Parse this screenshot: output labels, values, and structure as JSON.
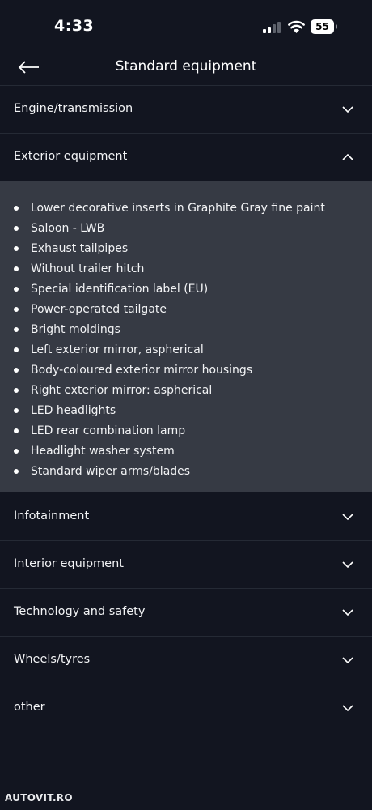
{
  "status_bar": {
    "time": "4:33",
    "battery": "55"
  },
  "header": {
    "back_icon": "arrow-left-icon",
    "title": "Standard equipment"
  },
  "sections": [
    {
      "label": "Engine/transmission",
      "expanded": false,
      "chevron": "chevron-down-icon"
    },
    {
      "label": "Exterior equipment",
      "expanded": true,
      "chevron": "chevron-up-icon"
    },
    {
      "label": "Infotainment",
      "expanded": false,
      "chevron": "chevron-down-icon"
    },
    {
      "label": "Interior equipment",
      "expanded": false,
      "chevron": "chevron-down-icon"
    },
    {
      "label": "Technology and safety",
      "expanded": false,
      "chevron": "chevron-down-icon"
    },
    {
      "label": "Wheels/tyres",
      "expanded": false,
      "chevron": "chevron-down-icon"
    },
    {
      "label": "other",
      "expanded": false,
      "chevron": "chevron-down-icon"
    }
  ],
  "exterior_items": [
    "Lower decorative inserts in Graphite Gray fine paint",
    "Saloon - LWB",
    "Exhaust tailpipes",
    "Without trailer hitch",
    "Special identification label (EU)",
    "Power-operated tailgate",
    "Bright moldings",
    "Left exterior mirror, aspherical",
    "Body-coloured exterior mirror housings",
    "Right exterior mirror: aspherical",
    "LED headlights",
    "LED rear combination lamp",
    "Headlight washer system",
    "Standard wiper arms/blades"
  ],
  "watermark": "AUTOVIT.RO",
  "colors": {
    "background": "#121520",
    "expanded_panel": "#363a44",
    "divider": "#252a35",
    "text": "#f2f3f5"
  }
}
